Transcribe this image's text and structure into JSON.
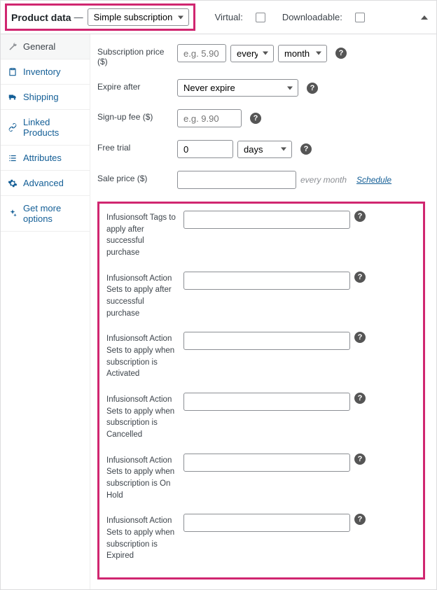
{
  "header": {
    "title": "Product data",
    "dash": "—",
    "product_type": "Simple subscription",
    "virtual_label": "Virtual:",
    "downloadable_label": "Downloadable:"
  },
  "sidebar": {
    "items": [
      {
        "label": "General"
      },
      {
        "label": "Inventory"
      },
      {
        "label": "Shipping"
      },
      {
        "label": "Linked Products"
      },
      {
        "label": "Attributes"
      },
      {
        "label": "Advanced"
      },
      {
        "label": "Get more options"
      }
    ]
  },
  "fields": {
    "sub_price": {
      "label": "Subscription price ($)",
      "placeholder": "e.g. 5.90",
      "freq": "every",
      "period": "month"
    },
    "expire": {
      "label": "Expire after",
      "value": "Never expire"
    },
    "signup": {
      "label": "Sign-up fee ($)",
      "placeholder": "e.g. 9.90"
    },
    "trial": {
      "label": "Free trial",
      "value": "0",
      "unit": "days"
    },
    "sale": {
      "label": "Sale price ($)",
      "suffix": "every month",
      "schedule": "Schedule"
    }
  },
  "infusion": {
    "tags_purchase": {
      "label": "Infusionsoft Tags to apply after successful purchase"
    },
    "actions_purchase": {
      "label": "Infusionsoft Action Sets to apply after successful purchase"
    },
    "actions_activated": {
      "label": "Infusionsoft Action Sets to apply when subscription is Activated"
    },
    "actions_cancelled": {
      "label": "Infusionsoft Action Sets to apply when subscription is Cancelled"
    },
    "actions_onhold": {
      "label": "Infusionsoft Action Sets to apply when subscription is On Hold"
    },
    "actions_expired": {
      "label": "Infusionsoft Action Sets to apply when subscription is Expired"
    }
  }
}
